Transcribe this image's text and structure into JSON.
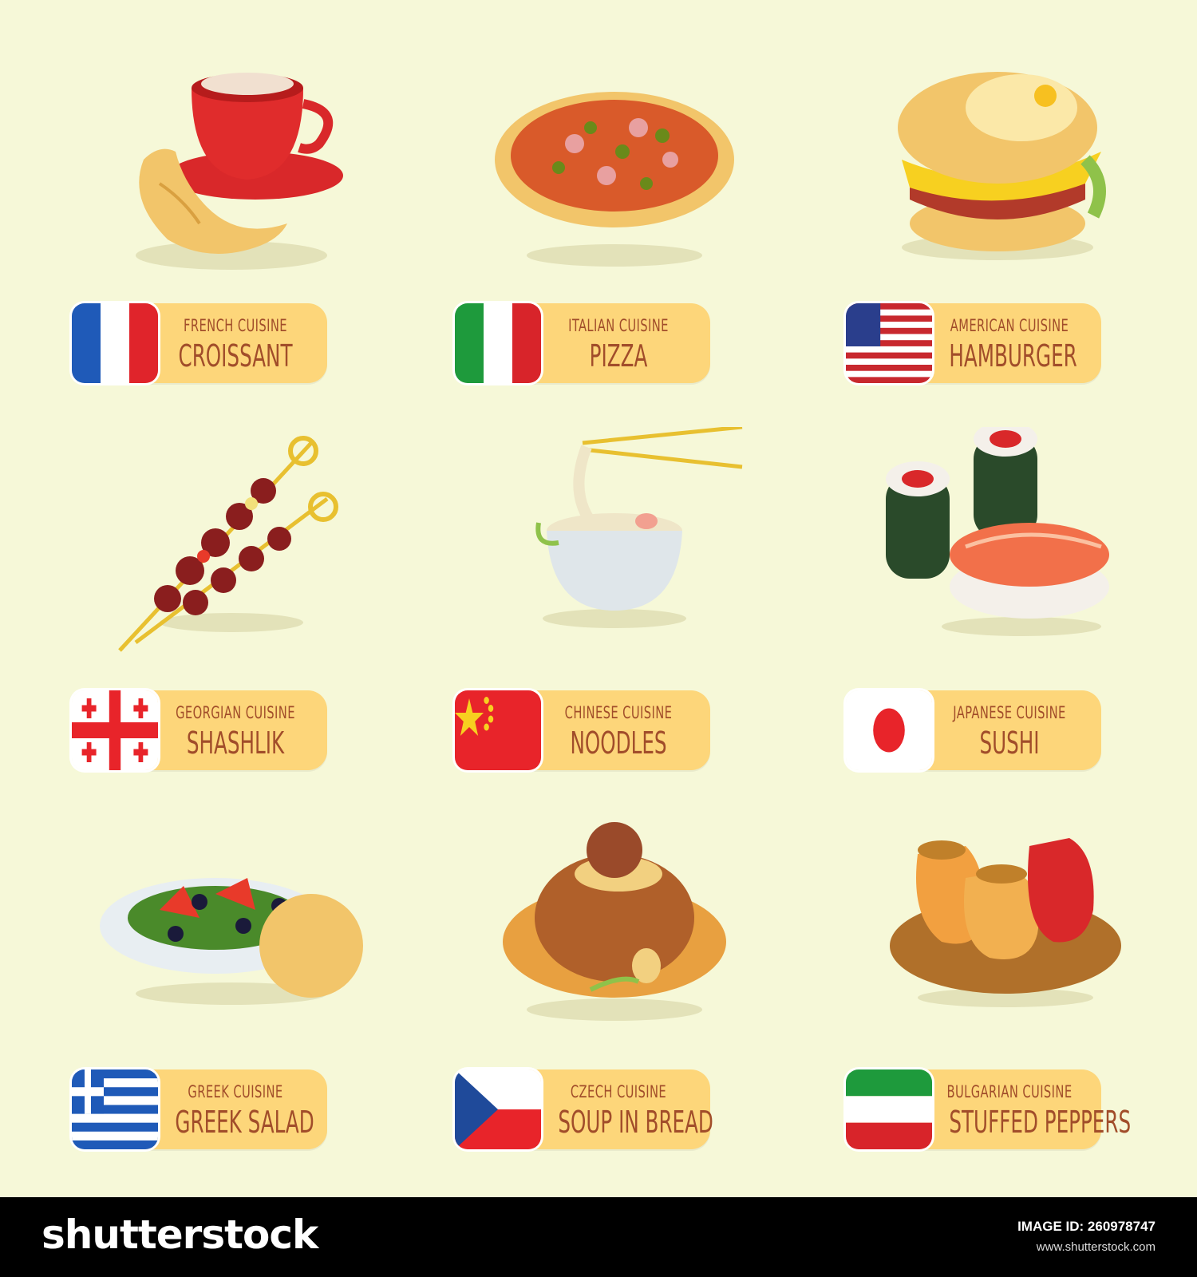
{
  "items": [
    {
      "cuisine": "French Cuisine",
      "dish": "Croissant",
      "flag": "france"
    },
    {
      "cuisine": "Italian Cuisine",
      "dish": "Pizza",
      "flag": "italy"
    },
    {
      "cuisine": "American Cuisine",
      "dish": "Hamburger",
      "flag": "usa"
    },
    {
      "cuisine": "Georgian Cuisine",
      "dish": "Shashlik",
      "flag": "georgia"
    },
    {
      "cuisine": "Chinese Cuisine",
      "dish": "Noodles",
      "flag": "china"
    },
    {
      "cuisine": "Japanese Cuisine",
      "dish": "Sushi",
      "flag": "japan"
    },
    {
      "cuisine": "Greek Cuisine",
      "dish": "Greek Salad",
      "flag": "greece"
    },
    {
      "cuisine": "Czech Cuisine",
      "dish": "Soup in Bread",
      "flag": "czech"
    },
    {
      "cuisine": "Bulgarian Cuisine",
      "dish": "Stuffed Peppers",
      "flag": "bulgaria"
    }
  ],
  "footer": {
    "brand": "shutterstock",
    "image_id": "IMAGE ID: 260978747",
    "url": "www.shutterstock.com"
  },
  "colors": {
    "background": "#f6f8d8",
    "label": "#fdd67a",
    "label_text": "#a14d2a"
  }
}
